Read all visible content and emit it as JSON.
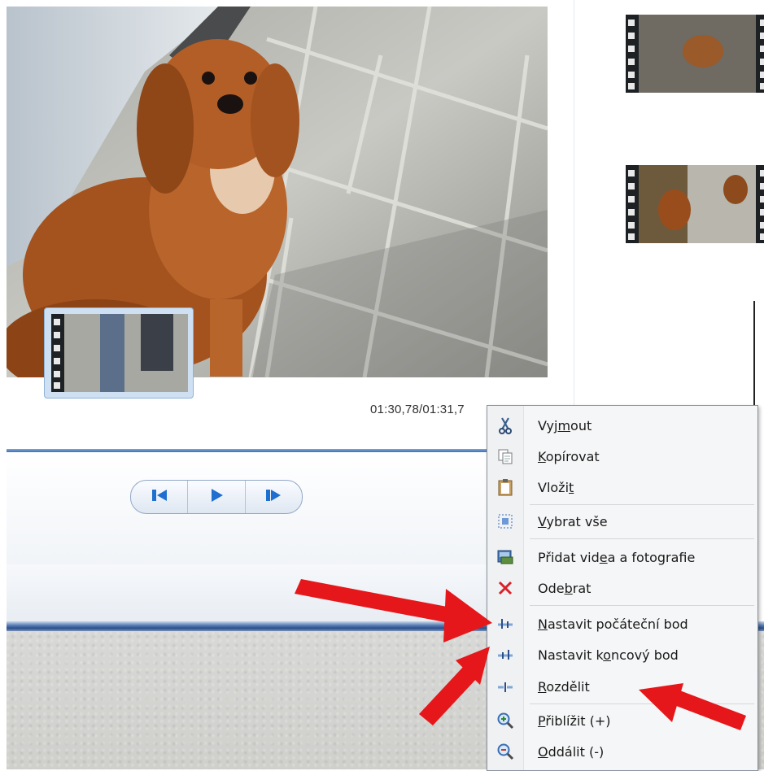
{
  "player": {
    "timecode": "01:30,78/01:31,7",
    "controls": {
      "prev_frame_icon": "step-back-icon",
      "play_icon": "play-icon",
      "next_frame_icon": "step-forward-icon"
    }
  },
  "storyboard": {
    "clips": [
      {
        "name": "clip-1",
        "selected": false
      },
      {
        "name": "clip-2",
        "selected": false
      },
      {
        "name": "clip-3",
        "selected": true
      }
    ]
  },
  "context_menu": {
    "items": [
      {
        "pre": "Vyj",
        "ul": "m",
        "post": "out",
        "icon": "scissors-icon"
      },
      {
        "pre": "",
        "ul": "K",
        "post": "opírovat",
        "icon": "copy-icon"
      },
      {
        "pre": "Vloži",
        "ul": "t",
        "post": "",
        "icon": "paste-icon"
      },
      {
        "pre": "",
        "ul": "V",
        "post": "ybrat vše",
        "icon": "select-all-icon"
      },
      {
        "pre": "Přidat vid",
        "ul": "e",
        "post": "a a fotografie",
        "icon": "add-media-icon"
      },
      {
        "pre": "Ode",
        "ul": "b",
        "post": "rat",
        "icon": "remove-icon"
      },
      {
        "pre": "",
        "ul": "N",
        "post": "astavit počáteční bod",
        "icon": "set-start-point-icon"
      },
      {
        "pre": "Nastavit k",
        "ul": "o",
        "post": "ncový bod",
        "icon": "set-end-point-icon"
      },
      {
        "pre": "",
        "ul": "R",
        "post": "ozdělit",
        "icon": "split-icon"
      },
      {
        "pre": "",
        "ul": "P",
        "post": "řiblížit (+)",
        "icon": "zoom-in-icon"
      },
      {
        "pre": "",
        "ul": "O",
        "post": "ddálit (-)",
        "icon": "zoom-out-icon"
      }
    ]
  },
  "colors": {
    "accent": "#1e6fd0",
    "arrow": "#e5171a",
    "remove_icon": "#d8222a"
  }
}
